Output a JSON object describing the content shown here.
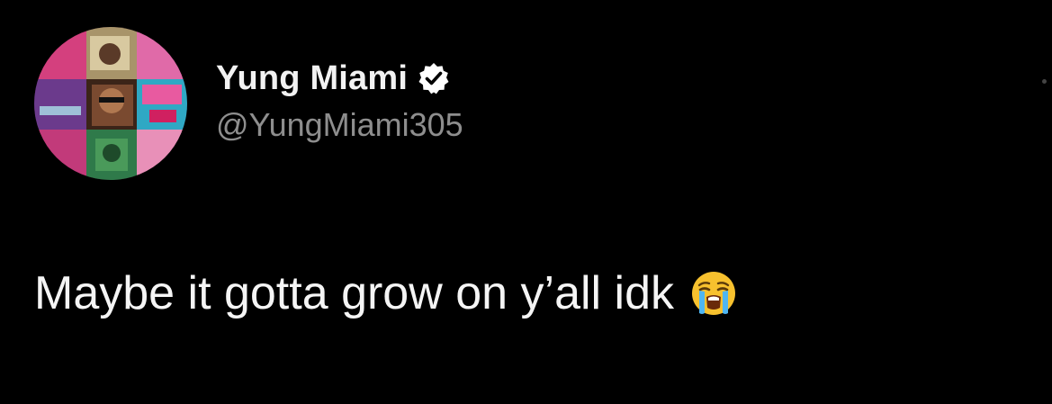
{
  "tweet": {
    "author": {
      "display_name": "Yung Miami",
      "handle": "@YungMiami305",
      "verified": true,
      "avatar_icon": "profile-photo-collage"
    },
    "text": "Maybe it gotta grow on y’all idk",
    "emoji_icon": "loudly-crying-face"
  },
  "colors": {
    "background": "#000000",
    "name": "#f2f2f2",
    "handle": "#8e8e8e",
    "text": "#f5f5f5",
    "verified_badge": "#ffffff"
  }
}
